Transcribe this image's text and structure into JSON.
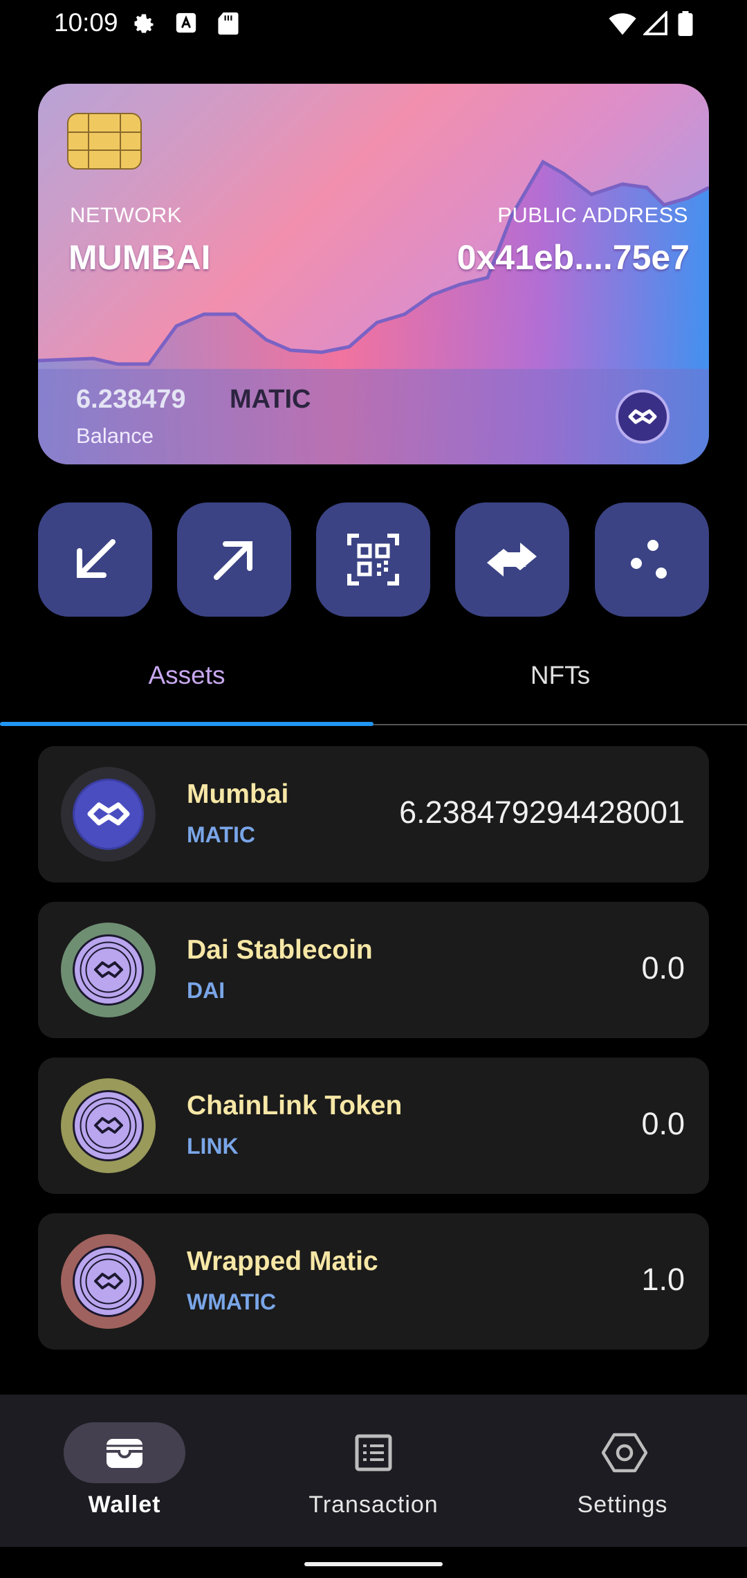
{
  "status_bar": {
    "time": "10:09",
    "left_icons": [
      "gear-icon",
      "text-icon",
      "sd-card-icon"
    ],
    "right_icons": [
      "wifi-icon",
      "signal-icon",
      "battery-icon"
    ]
  },
  "card": {
    "network_label": "NETWORK",
    "network_value": "MUMBAI",
    "address_label": "PUBLIC ADDRESS",
    "address_value": "0x41eb....75e7",
    "balance_amount": "6.238479",
    "balance_unit": "MATIC",
    "balance_label": "Balance",
    "token_icon": "polygon-icon"
  },
  "actions": [
    {
      "name": "receive-button",
      "icon": "arrow-down-left-icon"
    },
    {
      "name": "send-button",
      "icon": "arrow-up-right-icon"
    },
    {
      "name": "scan-qr-button",
      "icon": "qr-code-icon"
    },
    {
      "name": "swap-button",
      "icon": "swap-arrows-icon"
    },
    {
      "name": "more-button",
      "icon": "dots-icon"
    }
  ],
  "tabs": [
    {
      "label": "Assets",
      "active": true
    },
    {
      "label": "NFTs",
      "active": false
    }
  ],
  "assets": [
    {
      "name": "Mumbai",
      "symbol": "MATIC",
      "balance": "6.238479294428001",
      "icon_bg": "#2d2d33"
    },
    {
      "name": "Dai Stablecoin",
      "symbol": "DAI",
      "balance": "0.0",
      "icon_bg": "#6f8f72"
    },
    {
      "name": "ChainLink Token",
      "symbol": "LINK",
      "balance": "0.0",
      "icon_bg": "#9a9a5a"
    },
    {
      "name": "Wrapped Matic",
      "symbol": "WMATIC",
      "balance": "1.0",
      "icon_bg": "#a0625e"
    }
  ],
  "nav": [
    {
      "label": "Wallet",
      "icon": "wallet-icon",
      "active": true
    },
    {
      "label": "Transaction",
      "icon": "list-icon",
      "active": false
    },
    {
      "label": "Settings",
      "icon": "hexagon-settings-icon",
      "active": false
    }
  ],
  "colors": {
    "accent_blue": "#2196f3",
    "tab_active": "#c8a8f0",
    "button_bg": "#3b4384",
    "asset_name": "#f7e7a6",
    "asset_symbol": "#7aa6e8"
  }
}
